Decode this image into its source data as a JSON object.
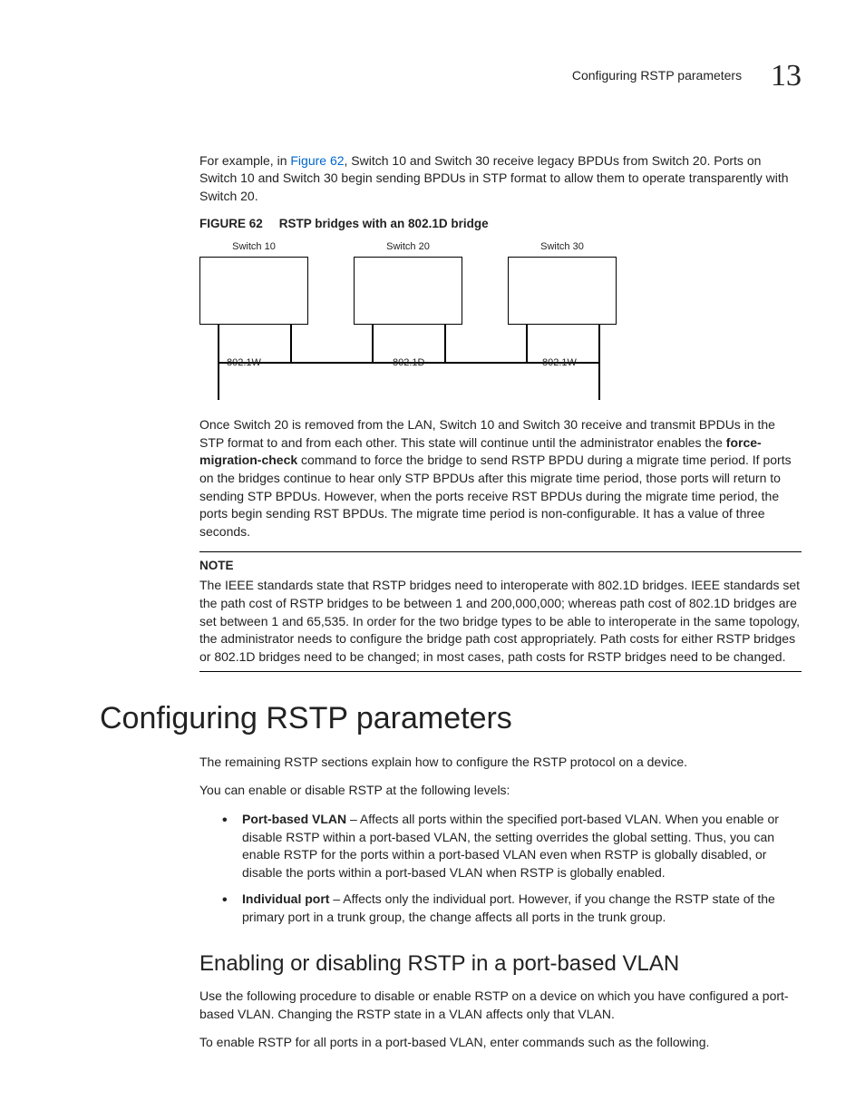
{
  "header": {
    "running_title": "Configuring RSTP parameters",
    "chapter_number": "13"
  },
  "intro": {
    "prefix": "For example, in ",
    "figref": "Figure 62",
    "suffix": ", Switch 10 and Switch 30 receive legacy BPDUs from Switch 20. Ports on Switch 10 and Switch 30 begin sending BPDUs in STP format to allow them to operate transparently with Switch 20."
  },
  "figure": {
    "label": "FIGURE 62",
    "title": "RSTP bridges with an 802.1D bridge",
    "sw1": "Switch 10",
    "sw2": "Switch 20",
    "sw3": "Switch 30",
    "p1": "802.1W",
    "p2": "802.1D",
    "p3": "802.1W"
  },
  "para2": {
    "a": "Once Switch 20 is removed from the LAN, Switch 10 and Switch 30 receive and transmit BPDUs in the STP format to and from each other. This state will continue until the administrator enables the ",
    "cmd": "force-migration-check",
    "b": " command to force the bridge to send RSTP BPDU during a migrate time period. If ports on the bridges continue to hear only STP BPDUs after this migrate time period, those ports will return to sending STP BPDUs. However, when the ports receive RST BPDUs during the migrate time period, the ports begin sending RST BPDUs. The migrate time period is non-configurable. It has a value of three seconds."
  },
  "note": {
    "label": "NOTE",
    "body": "The IEEE standards state that RSTP bridges need to interoperate with 802.1D bridges. IEEE standards set the path cost of RSTP bridges to be between 1 and 200,000,000; whereas path cost of 802.1D bridges are set between 1 and 65,535. In order for the two bridge types to be able to interoperate in the same topology, the administrator needs to configure the bridge path cost appropriately. Path costs for either RSTP bridges or 802.1D bridges need to be changed; in most cases, path costs for RSTP bridges need to be changed."
  },
  "section": {
    "title": "Configuring RSTP parameters",
    "p1": "The remaining RSTP sections explain how to configure the RSTP protocol on a device.",
    "p2": "You can enable or disable RSTP at the following levels:",
    "li1_b": "Port-based VLAN",
    "li1": " – Affects all ports within the specified port-based VLAN.  When you enable or disable RSTP within a port-based VLAN, the setting overrides the global setting.  Thus, you can enable RSTP for the ports within a port-based VLAN even when RSTP is globally disabled, or disable the ports within a port-based VLAN when RSTP is globally enabled.",
    "li2_b": "Individual port",
    "li2": " – Affects only the individual port.  However, if you change the RSTP state of the primary port in a trunk group, the change affects all ports in the trunk group."
  },
  "subsection": {
    "title": "Enabling or disabling RSTP in a port-based VLAN",
    "p1": "Use the following procedure to disable or enable RSTP on a device on which you have configured a port-based VLAN. Changing the RSTP state in a VLAN affects only that VLAN.",
    "p2": "To enable RSTP for all ports in a port-based VLAN, enter commands such as the following."
  }
}
